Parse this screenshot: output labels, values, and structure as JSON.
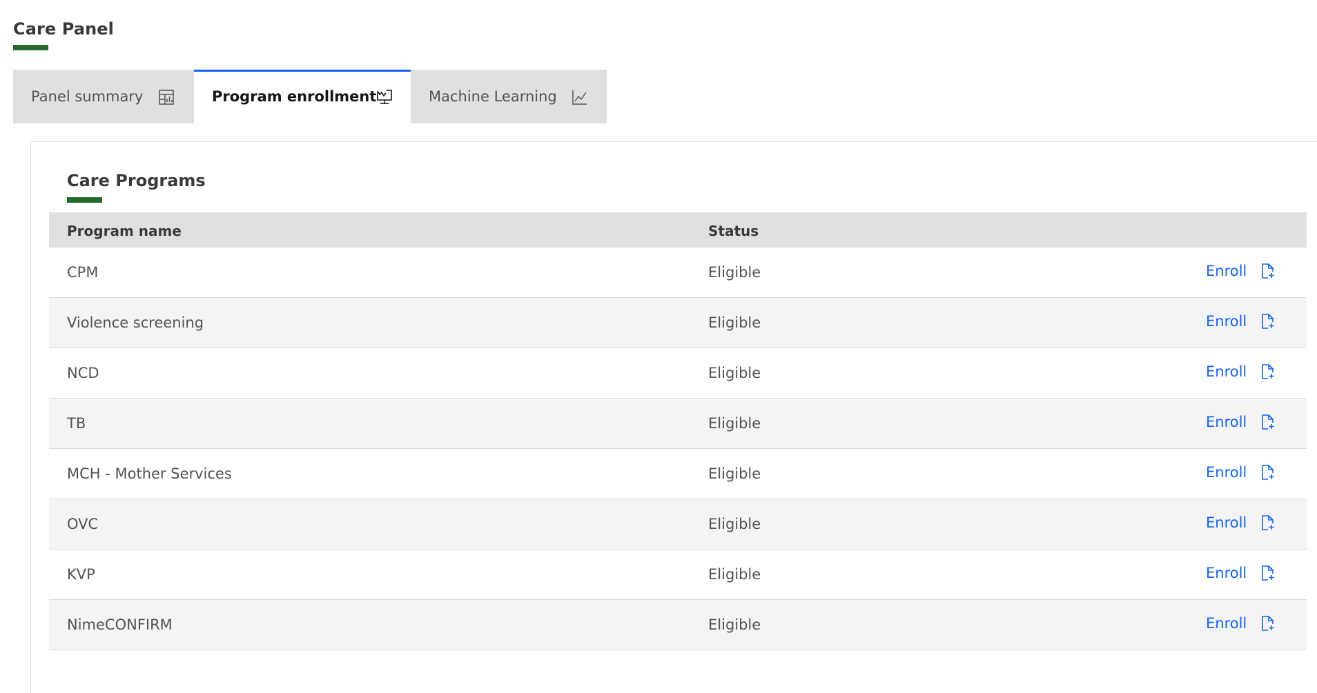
{
  "header": {
    "title": "Care Panel",
    "accent_color": "#24692b"
  },
  "tabs": [
    {
      "label": "Panel summary",
      "icon": "table-chart-icon",
      "active": false
    },
    {
      "label": "Program enrollment",
      "icon": "monitor-chart-icon",
      "active": true
    },
    {
      "label": "Machine Learning",
      "icon": "line-chart-icon",
      "active": false
    }
  ],
  "section": {
    "title": "Care Programs"
  },
  "table": {
    "headers": {
      "program_name": "Program name",
      "status": "Status"
    },
    "action_label": "Enroll",
    "action_icon": "document-add-icon",
    "rows": [
      {
        "name": "CPM",
        "status": "Eligible"
      },
      {
        "name": "Violence screening",
        "status": "Eligible"
      },
      {
        "name": "NCD",
        "status": "Eligible"
      },
      {
        "name": "TB",
        "status": "Eligible"
      },
      {
        "name": "MCH - Mother Services",
        "status": "Eligible"
      },
      {
        "name": "OVC",
        "status": "Eligible"
      },
      {
        "name": "KVP",
        "status": "Eligible"
      },
      {
        "name": "NimeCONFIRM",
        "status": "Eligible"
      }
    ]
  },
  "colors": {
    "link": "#0f62fe",
    "active_tab_indicator": "#0f62fe",
    "header_bg": "#e0e0e0"
  }
}
